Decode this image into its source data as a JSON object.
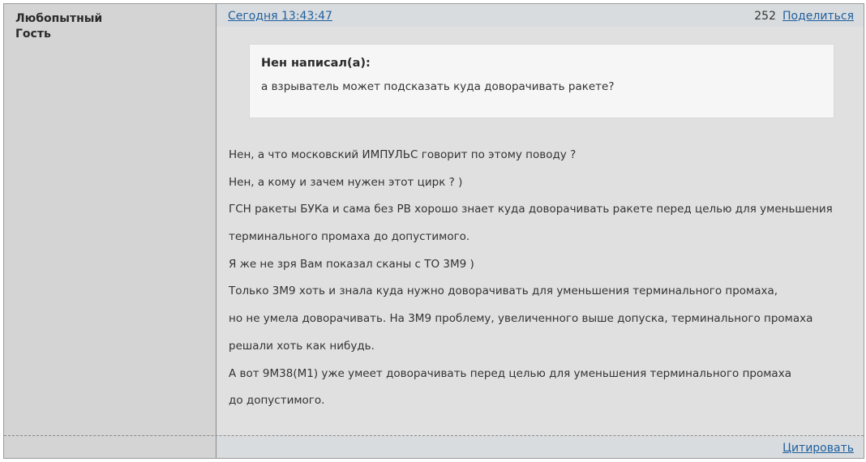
{
  "author": {
    "name": "Любопытный",
    "role": "Гость"
  },
  "header": {
    "timestamp": "Сегодня 13:43:47",
    "post_number": "252",
    "share_label": "Поделиться"
  },
  "quote": {
    "author": "Нен написал(а):",
    "text": "а взрыватель может подсказать куда доворачивать ракете?"
  },
  "message": {
    "lines": [
      "Нен, а что московский ИМПУЛЬС говорит по этому поводу ?",
      "Нен, а кому и зачем нужен этот цирк ? )",
      "ГСН ракеты БУКа и сама без РВ хорошо знает куда доворачивать ракете перед целью для уменьшения",
      "терминального промаха до допустимого.",
      "Я же не зря Вам показал сканы с ТО 3М9 )",
      "Только 3М9 хоть и знала куда нужно доворачивать для уменьшения терминального промаха,",
      "но не умела доворачивать. На 3М9 проблему, увеличенного выше допуска, терминального промаха",
      "решали хоть как нибудь.",
      "А вот 9М38(М1) уже умеет доворачивать перед целью для уменьшения терминального промаха",
      "до допустимого."
    ]
  },
  "footer": {
    "quote_label": "Цитировать"
  }
}
